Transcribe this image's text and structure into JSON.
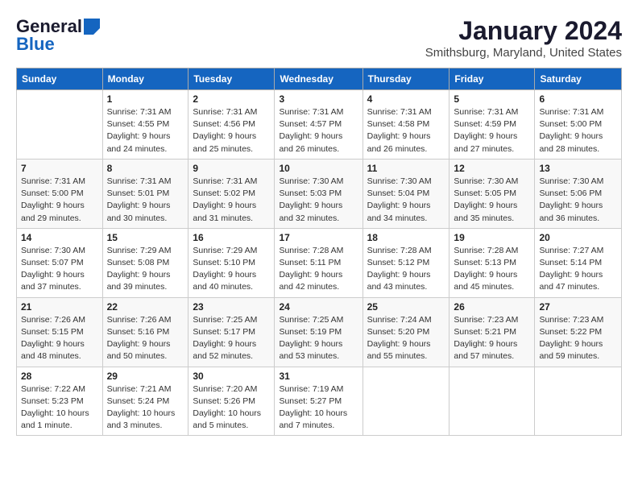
{
  "header": {
    "logo_general": "General",
    "logo_blue": "Blue",
    "title": "January 2024",
    "subtitle": "Smithsburg, Maryland, United States"
  },
  "calendar": {
    "days_of_week": [
      "Sunday",
      "Monday",
      "Tuesday",
      "Wednesday",
      "Thursday",
      "Friday",
      "Saturday"
    ],
    "weeks": [
      [
        {
          "day": "",
          "sunrise": "",
          "sunset": "",
          "daylight": ""
        },
        {
          "day": "1",
          "sunrise": "Sunrise: 7:31 AM",
          "sunset": "Sunset: 4:55 PM",
          "daylight": "Daylight: 9 hours and 24 minutes."
        },
        {
          "day": "2",
          "sunrise": "Sunrise: 7:31 AM",
          "sunset": "Sunset: 4:56 PM",
          "daylight": "Daylight: 9 hours and 25 minutes."
        },
        {
          "day": "3",
          "sunrise": "Sunrise: 7:31 AM",
          "sunset": "Sunset: 4:57 PM",
          "daylight": "Daylight: 9 hours and 26 minutes."
        },
        {
          "day": "4",
          "sunrise": "Sunrise: 7:31 AM",
          "sunset": "Sunset: 4:58 PM",
          "daylight": "Daylight: 9 hours and 26 minutes."
        },
        {
          "day": "5",
          "sunrise": "Sunrise: 7:31 AM",
          "sunset": "Sunset: 4:59 PM",
          "daylight": "Daylight: 9 hours and 27 minutes."
        },
        {
          "day": "6",
          "sunrise": "Sunrise: 7:31 AM",
          "sunset": "Sunset: 5:00 PM",
          "daylight": "Daylight: 9 hours and 28 minutes."
        }
      ],
      [
        {
          "day": "7",
          "sunrise": "Sunrise: 7:31 AM",
          "sunset": "Sunset: 5:00 PM",
          "daylight": "Daylight: 9 hours and 29 minutes."
        },
        {
          "day": "8",
          "sunrise": "Sunrise: 7:31 AM",
          "sunset": "Sunset: 5:01 PM",
          "daylight": "Daylight: 9 hours and 30 minutes."
        },
        {
          "day": "9",
          "sunrise": "Sunrise: 7:31 AM",
          "sunset": "Sunset: 5:02 PM",
          "daylight": "Daylight: 9 hours and 31 minutes."
        },
        {
          "day": "10",
          "sunrise": "Sunrise: 7:30 AM",
          "sunset": "Sunset: 5:03 PM",
          "daylight": "Daylight: 9 hours and 32 minutes."
        },
        {
          "day": "11",
          "sunrise": "Sunrise: 7:30 AM",
          "sunset": "Sunset: 5:04 PM",
          "daylight": "Daylight: 9 hours and 34 minutes."
        },
        {
          "day": "12",
          "sunrise": "Sunrise: 7:30 AM",
          "sunset": "Sunset: 5:05 PM",
          "daylight": "Daylight: 9 hours and 35 minutes."
        },
        {
          "day": "13",
          "sunrise": "Sunrise: 7:30 AM",
          "sunset": "Sunset: 5:06 PM",
          "daylight": "Daylight: 9 hours and 36 minutes."
        }
      ],
      [
        {
          "day": "14",
          "sunrise": "Sunrise: 7:30 AM",
          "sunset": "Sunset: 5:07 PM",
          "daylight": "Daylight: 9 hours and 37 minutes."
        },
        {
          "day": "15",
          "sunrise": "Sunrise: 7:29 AM",
          "sunset": "Sunset: 5:08 PM",
          "daylight": "Daylight: 9 hours and 39 minutes."
        },
        {
          "day": "16",
          "sunrise": "Sunrise: 7:29 AM",
          "sunset": "Sunset: 5:10 PM",
          "daylight": "Daylight: 9 hours and 40 minutes."
        },
        {
          "day": "17",
          "sunrise": "Sunrise: 7:28 AM",
          "sunset": "Sunset: 5:11 PM",
          "daylight": "Daylight: 9 hours and 42 minutes."
        },
        {
          "day": "18",
          "sunrise": "Sunrise: 7:28 AM",
          "sunset": "Sunset: 5:12 PM",
          "daylight": "Daylight: 9 hours and 43 minutes."
        },
        {
          "day": "19",
          "sunrise": "Sunrise: 7:28 AM",
          "sunset": "Sunset: 5:13 PM",
          "daylight": "Daylight: 9 hours and 45 minutes."
        },
        {
          "day": "20",
          "sunrise": "Sunrise: 7:27 AM",
          "sunset": "Sunset: 5:14 PM",
          "daylight": "Daylight: 9 hours and 47 minutes."
        }
      ],
      [
        {
          "day": "21",
          "sunrise": "Sunrise: 7:26 AM",
          "sunset": "Sunset: 5:15 PM",
          "daylight": "Daylight: 9 hours and 48 minutes."
        },
        {
          "day": "22",
          "sunrise": "Sunrise: 7:26 AM",
          "sunset": "Sunset: 5:16 PM",
          "daylight": "Daylight: 9 hours and 50 minutes."
        },
        {
          "day": "23",
          "sunrise": "Sunrise: 7:25 AM",
          "sunset": "Sunset: 5:17 PM",
          "daylight": "Daylight: 9 hours and 52 minutes."
        },
        {
          "day": "24",
          "sunrise": "Sunrise: 7:25 AM",
          "sunset": "Sunset: 5:19 PM",
          "daylight": "Daylight: 9 hours and 53 minutes."
        },
        {
          "day": "25",
          "sunrise": "Sunrise: 7:24 AM",
          "sunset": "Sunset: 5:20 PM",
          "daylight": "Daylight: 9 hours and 55 minutes."
        },
        {
          "day": "26",
          "sunrise": "Sunrise: 7:23 AM",
          "sunset": "Sunset: 5:21 PM",
          "daylight": "Daylight: 9 hours and 57 minutes."
        },
        {
          "day": "27",
          "sunrise": "Sunrise: 7:23 AM",
          "sunset": "Sunset: 5:22 PM",
          "daylight": "Daylight: 9 hours and 59 minutes."
        }
      ],
      [
        {
          "day": "28",
          "sunrise": "Sunrise: 7:22 AM",
          "sunset": "Sunset: 5:23 PM",
          "daylight": "Daylight: 10 hours and 1 minute."
        },
        {
          "day": "29",
          "sunrise": "Sunrise: 7:21 AM",
          "sunset": "Sunset: 5:24 PM",
          "daylight": "Daylight: 10 hours and 3 minutes."
        },
        {
          "day": "30",
          "sunrise": "Sunrise: 7:20 AM",
          "sunset": "Sunset: 5:26 PM",
          "daylight": "Daylight: 10 hours and 5 minutes."
        },
        {
          "day": "31",
          "sunrise": "Sunrise: 7:19 AM",
          "sunset": "Sunset: 5:27 PM",
          "daylight": "Daylight: 10 hours and 7 minutes."
        },
        {
          "day": "",
          "sunrise": "",
          "sunset": "",
          "daylight": ""
        },
        {
          "day": "",
          "sunrise": "",
          "sunset": "",
          "daylight": ""
        },
        {
          "day": "",
          "sunrise": "",
          "sunset": "",
          "daylight": ""
        }
      ]
    ]
  }
}
